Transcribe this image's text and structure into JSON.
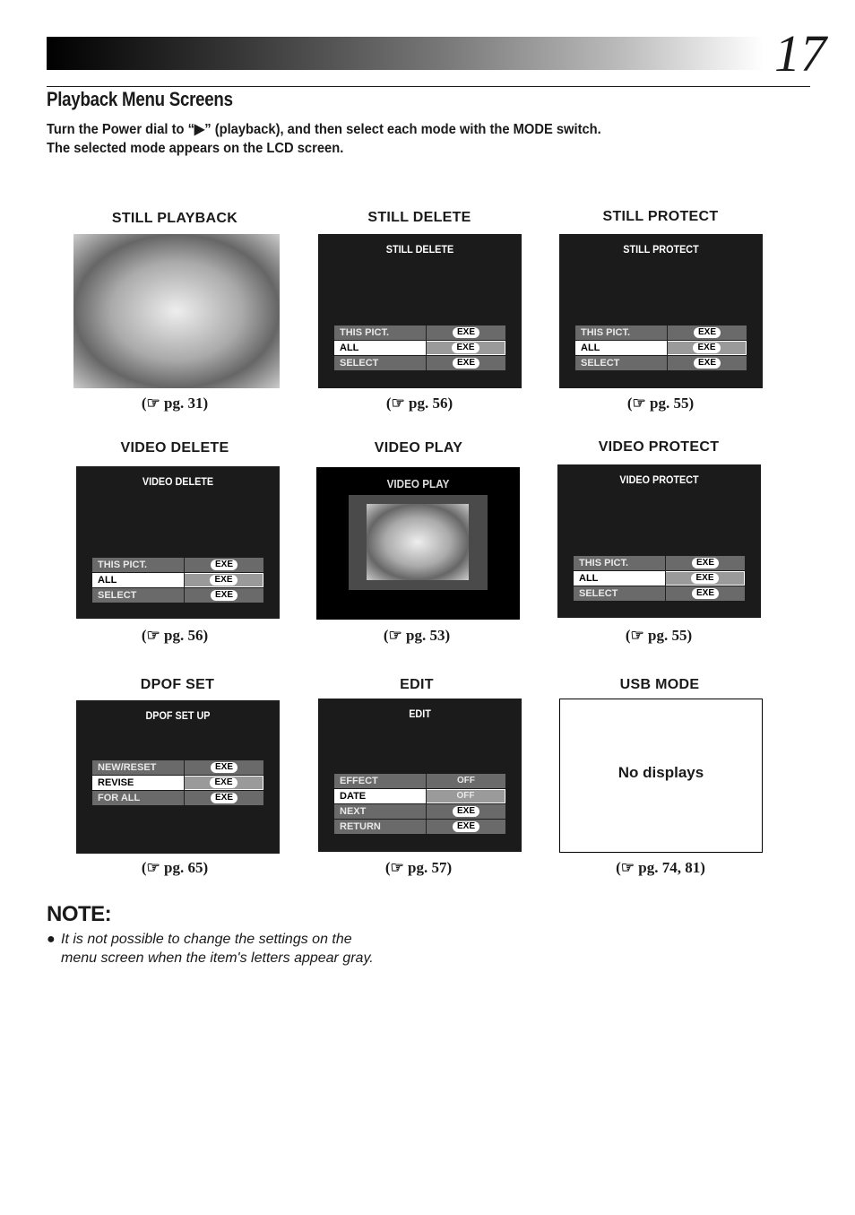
{
  "page": {
    "number": "17",
    "title": "Playback Menu Screens",
    "intro_line1": "Turn the Power dial to “▶” (playback), and then select each mode with the MODE switch.",
    "intro_line2": "The selected mode appears on the LCD screen."
  },
  "screens": [
    {
      "label": "STILL PLAYBACK",
      "ref": "(☞ pg. 31)"
    },
    {
      "label": "STILL DELETE",
      "ref": "(☞ pg. 56)",
      "lcd_title": "STILL DELETE",
      "rows": [
        {
          "k": "THIS PICT.",
          "v": "EXE"
        },
        {
          "k": "ALL",
          "v": "EXE"
        },
        {
          "k": "SELECT",
          "v": "EXE"
        }
      ]
    },
    {
      "label": "STILL PROTECT",
      "ref": "(☞ pg. 55)",
      "lcd_title": "STILL PROTECT",
      "rows": [
        {
          "k": "THIS PICT.",
          "v": "EXE"
        },
        {
          "k": "ALL",
          "v": "EXE"
        },
        {
          "k": "SELECT",
          "v": "EXE"
        }
      ]
    },
    {
      "label": "VIDEO DELETE",
      "ref": "(☞ pg. 56)",
      "lcd_title": "VIDEO DELETE",
      "rows": [
        {
          "k": "THIS PICT.",
          "v": "EXE"
        },
        {
          "k": "ALL",
          "v": "EXE"
        },
        {
          "k": "SELECT",
          "v": "EXE"
        }
      ]
    },
    {
      "label": "VIDEO PLAY",
      "ref": "(☞ pg. 53)",
      "lcd_title": "VIDEO PLAY"
    },
    {
      "label": "VIDEO PROTECT",
      "ref": "(☞ pg. 55)",
      "lcd_title": "VIDEO PROTECT",
      "rows": [
        {
          "k": "THIS PICT.",
          "v": "EXE"
        },
        {
          "k": "ALL",
          "v": "EXE"
        },
        {
          "k": "SELECT",
          "v": "EXE"
        }
      ]
    },
    {
      "label": "DPOF SET",
      "ref": "(☞ pg. 65)",
      "lcd_title": "DPOF SET UP",
      "rows": [
        {
          "k": "NEW/RESET",
          "v": "EXE"
        },
        {
          "k": "REVISE",
          "v": "EXE"
        },
        {
          "k": "FOR ALL",
          "v": "EXE"
        }
      ]
    },
    {
      "label": "EDIT",
      "ref": "(☞ pg. 57)",
      "lcd_title": "EDIT",
      "rows": [
        {
          "k": "EFFECT",
          "v": "OFF"
        },
        {
          "k": "DATE",
          "v": "OFF"
        },
        {
          "k": "NEXT",
          "v": "EXE"
        },
        {
          "k": "RETURN",
          "v": "EXE"
        }
      ]
    },
    {
      "label": "USB MODE",
      "ref": "(☞ pg. 74, 81)",
      "text": "No displays"
    }
  ],
  "note": {
    "heading": "NOTE:",
    "bullet": "●",
    "line1": "It is not possible to change the settings on the",
    "line2": "menu screen when the item's letters appear gray."
  }
}
